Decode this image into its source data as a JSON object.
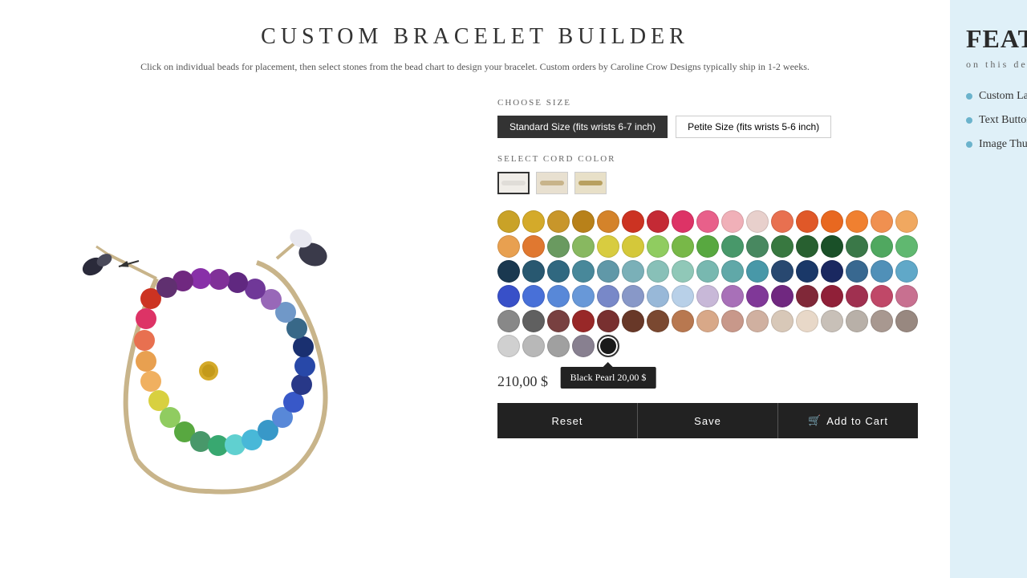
{
  "page": {
    "title": "CUSTOM BRACELET BUILDER",
    "subtitle": "Click on individual beads for placement, then select stones from the bead chart to design your bracelet. Custom orders by Caroline Crow Designs typically ship in 1-2 weeks."
  },
  "size": {
    "label": "CHOOSE SIZE",
    "options": [
      {
        "id": "standard",
        "label": "Standard Size (fits wrists 6-7 inch)",
        "active": true
      },
      {
        "id": "petite",
        "label": "Petite Size (fits wrists 5-6 inch)",
        "active": false
      }
    ]
  },
  "cord": {
    "label": "SELECT CORD COLOR",
    "options": [
      {
        "id": "white",
        "color": "#f0ede8"
      },
      {
        "id": "tan",
        "color": "#c8b48a"
      },
      {
        "id": "gold",
        "color": "#b8a060"
      }
    ]
  },
  "price": {
    "value": "210,00 $"
  },
  "buttons": {
    "reset": "Reset",
    "save": "Save",
    "add_to_cart": "Add to Cart"
  },
  "tooltip": {
    "label": "Black Pearl 20,00 $"
  },
  "beads": {
    "rows": [
      [
        "#c9a227",
        "#d4aa2a",
        "#c8962a",
        "#b8811a",
        "#d4832a",
        "#cc3322",
        "#c42a35",
        "#dd3366",
        "#e8608a",
        "#f0b0b8",
        "#e8d0cc",
        "#e87050",
        "#e05828",
        "#e86820"
      ],
      [
        "#e8a050",
        "#e07830",
        "#6a9a60",
        "#88b860",
        "#d8cc40",
        "#d4c83a",
        "#90cc60",
        "#78b848",
        "#58a840",
        "#48986a",
        "#488860",
        "#387840",
        "#286030",
        "#1a5028"
      ],
      [
        "#1a3850",
        "#285870",
        "#306880",
        "#48889a",
        "#6098a8",
        "#7ab0b8",
        "#88c0b8",
        "#90c8b8",
        "#78b8b0",
        "#60a8a8",
        "#4898a8",
        "#284870",
        "#1a3868",
        "#1a2860"
      ],
      [
        "#3850c8",
        "#4870d8",
        "#5888d8",
        "#6898d8",
        "#7888c8",
        "#8898c8",
        "#98b8d8",
        "#b8d0e8",
        "#c8b8d8",
        "#a870b8",
        "#803898",
        "#702880",
        "#802838",
        "#902038"
      ],
      [
        "#888888",
        "#606060",
        "#784040",
        "#982828",
        "#783030",
        "#683828",
        "#7a4830",
        "#b87850",
        "#d8a888",
        "#c8988a",
        "#d0b0a0",
        "#d8c8b8",
        "#e8d8c8",
        "#c8c0b8"
      ],
      [
        "#d0d0d0",
        "#b8b8b8",
        "#a0a0a0",
        "#888090",
        "#1a1a1a",
        "",
        "",
        "",
        "",
        "",
        "",
        "",
        "",
        ""
      ]
    ]
  },
  "selected_bead_index": {
    "row": 5,
    "col": 4
  },
  "features": {
    "title": "FEATURES",
    "subtitle": "on this demo:",
    "items": [
      "Custom Layers",
      "Text Buttons",
      "Image Thumbnails"
    ]
  }
}
